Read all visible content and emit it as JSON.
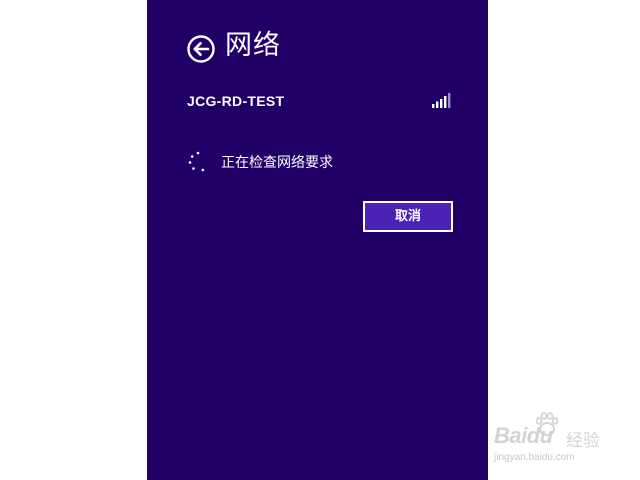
{
  "panel": {
    "title": "网络",
    "back_icon": "back-arrow-icon",
    "background": "#200067"
  },
  "network": {
    "ssid": "JCG-RD-TEST",
    "signal_icon": "wifi-signal-icon",
    "signal_level": 1.0
  },
  "status": {
    "spinner_icon": "loading-spinner-icon",
    "text": "正在检查网络要求"
  },
  "actions": {
    "cancel_label": "取消",
    "cancel_color": "#4b22b6"
  },
  "watermark": {
    "brand_text": "Baidu",
    "sub_text": "经验",
    "url": "jingyan.baidu.com"
  }
}
